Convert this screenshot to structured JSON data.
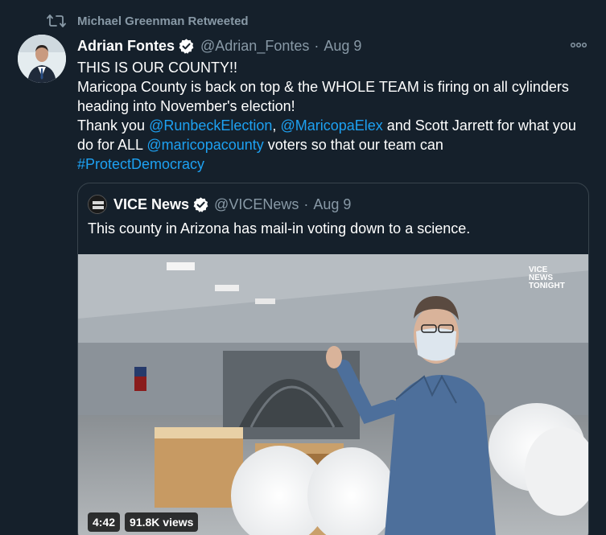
{
  "retweet": {
    "text": "Michael Greenman Retweeted",
    "icon": "retweet-icon"
  },
  "tweet": {
    "author_name": "Adrian Fontes",
    "handle": "@Adrian_Fontes",
    "separator": "·",
    "date": "Aug 9",
    "verified": true,
    "body": {
      "line1": "THIS IS OUR COUNTY!!",
      "line2": "Maricopa County is back on top & the WHOLE TEAM is firing on all cylinders",
      "line3": "heading into November's election!",
      "line4_a": "Thank you ",
      "mention1": "@RunbeckElection",
      "line4_b": ", ",
      "mention2": "@MaricopaElex",
      "line4_c": " and Scott Jarrett for what you",
      "line5_a": "do for ALL ",
      "mention3": "@maricopacounty",
      "line5_b": " voters so that our team can",
      "hashtag": "#ProtectDemocracy"
    }
  },
  "quote": {
    "author_name": "VICE News",
    "handle": "@VICENews",
    "separator": "·",
    "date": "Aug 9",
    "verified": true,
    "avatar_text": "VICE NEWS",
    "text": "This county in Arizona has mail-in voting down to a science.",
    "video": {
      "watermark_line1": "VICE",
      "watermark_line2": "NEWS",
      "watermark_line3": "TONIGHT",
      "duration": "4:42",
      "views": "91.8K views"
    }
  },
  "colors": {
    "background": "#15202b",
    "text_primary": "#ffffff",
    "text_secondary": "#8899a6",
    "link": "#1da1f2",
    "border": "#38444d"
  }
}
